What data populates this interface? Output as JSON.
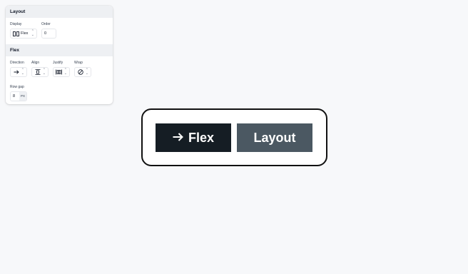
{
  "panel": {
    "layout": {
      "title": "Layout",
      "display": {
        "label": "Display",
        "value": "Flex"
      },
      "order": {
        "label": "Order",
        "value": "0"
      }
    },
    "flex": {
      "title": "Flex",
      "direction": {
        "label": "Direction",
        "icon": "arrow-right-icon"
      },
      "align": {
        "label": "Align",
        "icon": "align-center-icon"
      },
      "justify": {
        "label": "Justify",
        "icon": "justify-icon"
      },
      "wrap": {
        "label": "Wrap",
        "icon": "no-wrap-icon"
      },
      "row_gap": {
        "label": "Row gap",
        "value": "8",
        "unit": "PX"
      }
    }
  },
  "stage": {
    "button_flex": {
      "icon": "arrow-right-icon",
      "label": "Flex",
      "color": "#151d24"
    },
    "button_layout": {
      "label": "Layout",
      "color": "#4b5862"
    }
  }
}
